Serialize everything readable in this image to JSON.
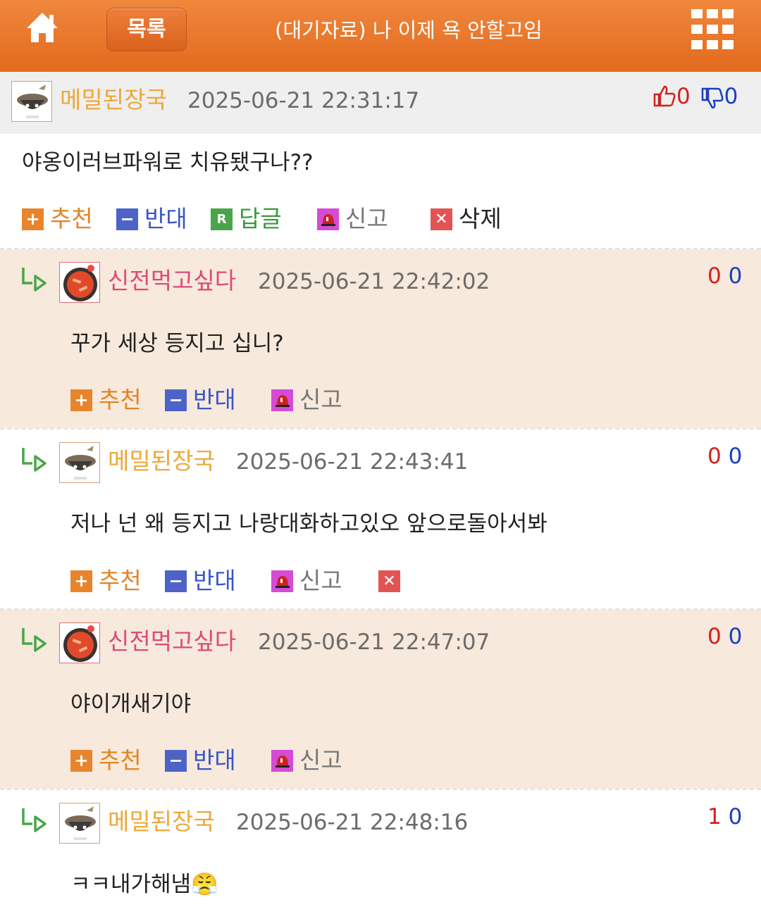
{
  "header": {
    "list_label": "목록",
    "title": "(대기자료) 나 이제 욕 안할고임"
  },
  "comments": [
    {
      "author": "메밀된장국",
      "date": "2025-06-21 22:31:17",
      "up": "0",
      "down": "0",
      "text": "야옹이러브파워로 치유됐구나??",
      "actions": {
        "recommend": "추천",
        "oppose": "반대",
        "reply": "답글",
        "report": "신고",
        "delete": "삭제"
      }
    },
    {
      "author": "신전먹고싶다",
      "date": "2025-06-21 22:42:02",
      "up": "0",
      "down": "0",
      "text": "꾸가 세상 등지고 십니?",
      "actions": {
        "recommend": "추천",
        "oppose": "반대",
        "report": "신고"
      }
    },
    {
      "author": "메밀된장국",
      "date": "2025-06-21 22:43:41",
      "up": "0",
      "down": "0",
      "text": "저나 넌 왜 등지고 나랑대화하고있오 앞으로돌아서봐",
      "actions": {
        "recommend": "추천",
        "oppose": "반대",
        "report": "신고"
      }
    },
    {
      "author": "신전먹고싶다",
      "date": "2025-06-21 22:47:07",
      "up": "0",
      "down": "0",
      "text": "야이개새기야",
      "actions": {
        "recommend": "추천",
        "oppose": "반대",
        "report": "신고"
      }
    },
    {
      "author": "메밀된장국",
      "date": "2025-06-21 22:48:16",
      "up": "1",
      "down": "0",
      "text": "ㅋㅋ내가해냄😤"
    }
  ],
  "icons": {
    "home": "home-icon",
    "grid": "grid-menu-icon",
    "thumb_up": "thumbs-up-icon",
    "thumb_down": "thumbs-down-icon",
    "reply_arrow": "reply-arrow-icon",
    "report": "siren-icon"
  },
  "colors": {
    "header": "#e8742a",
    "author_a": "#eda83a",
    "author_b": "#dc4b79",
    "vote_up": "#d22020",
    "vote_down": "#1a3fc0",
    "alt_row": "#f7e9db"
  }
}
